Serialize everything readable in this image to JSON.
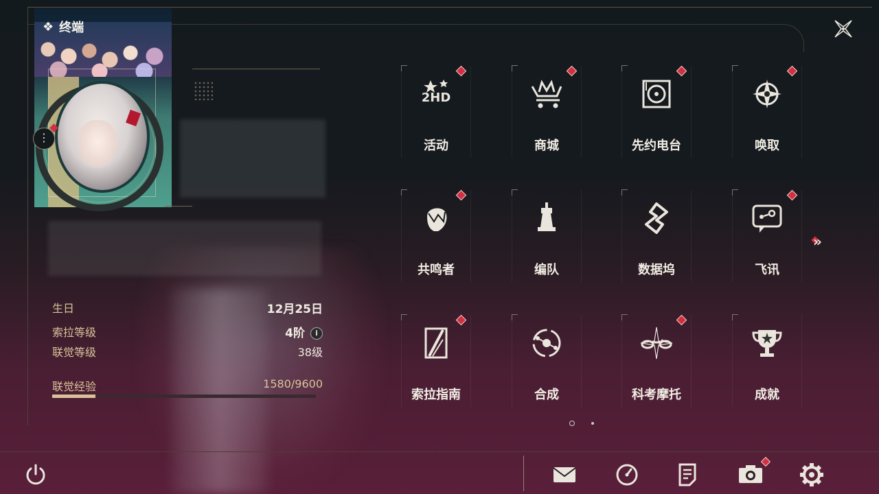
{
  "terminal": {
    "title": "终端",
    "icon": "diamond-cluster-icon"
  },
  "profile": {
    "birthday_label": "生日",
    "birthday_value": "12月25日",
    "sola_level_label": "索拉等级",
    "sola_level_value": "4阶",
    "union_level_label": "联觉等级",
    "union_level_value": "38级",
    "exp_label": "联觉经验",
    "exp_value": "1580/9600",
    "exp_progress": 0.165,
    "info_glyph": "i",
    "more_glyph": "⋮"
  },
  "menu": {
    "items": [
      {
        "label": "活动",
        "icon": "event-2hd-icon",
        "badge": true
      },
      {
        "label": "商城",
        "icon": "shop-cart-icon",
        "badge": true
      },
      {
        "label": "先约电台",
        "icon": "radio-record-icon",
        "badge": true
      },
      {
        "label": "唤取",
        "icon": "compass-star-icon",
        "badge": true
      },
      {
        "label": "共鸣者",
        "icon": "character-head-icon",
        "badge": true
      },
      {
        "label": "编队",
        "icon": "chess-team-icon",
        "badge": false
      },
      {
        "label": "数据坞",
        "icon": "data-dock-icon",
        "badge": false
      },
      {
        "label": "飞讯",
        "icon": "message-chat-icon",
        "badge": true
      },
      {
        "label": "索拉指南",
        "icon": "guide-book-icon",
        "badge": true
      },
      {
        "label": "合成",
        "icon": "synthesis-icon",
        "badge": false
      },
      {
        "label": "科考摩托",
        "icon": "motorbike-icon",
        "badge": true
      },
      {
        "label": "成就",
        "icon": "trophy-icon",
        "badge": false
      }
    ],
    "next_glyph": "»",
    "page_count": 2,
    "current_page": 1
  },
  "bottom_bar": {
    "items": [
      "power-icon",
      "mail-icon",
      "clock-icon",
      "notes-icon",
      "camera-icon",
      "settings-gear-icon"
    ]
  },
  "colors": {
    "accent_gold": "#d9c49a",
    "badge_red": "#d13040",
    "text_light": "#f1ede4"
  }
}
